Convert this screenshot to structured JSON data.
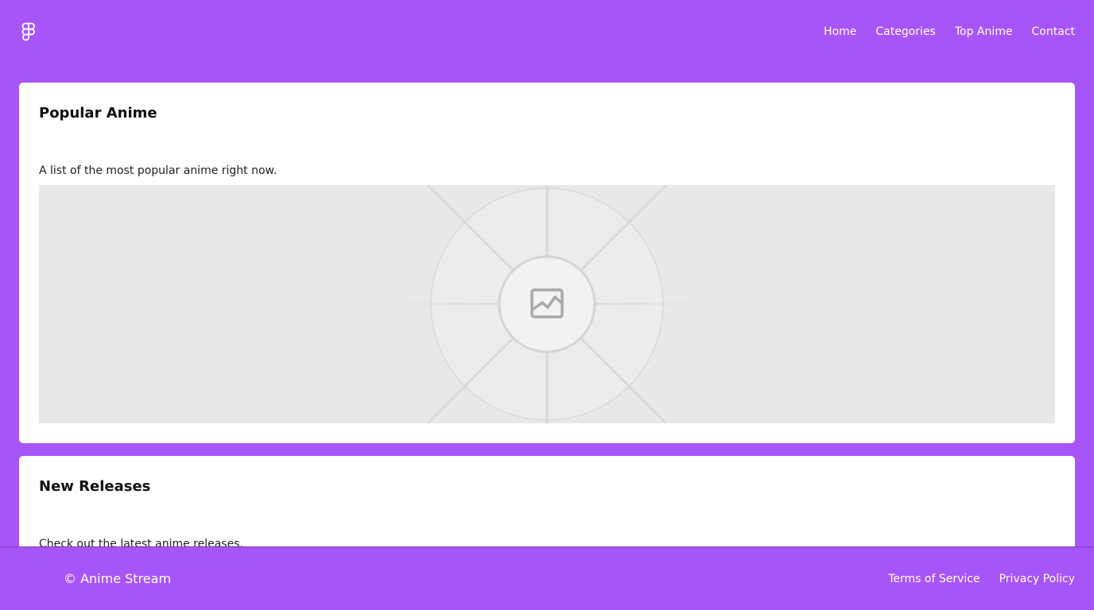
{
  "colors": {
    "brand_background": "#a855f7",
    "card_background": "#ffffff",
    "placeholder_background": "#e8e8e8"
  },
  "header": {
    "logo_icon": "figma-logo-icon",
    "nav": [
      {
        "label": "Home"
      },
      {
        "label": "Categories"
      },
      {
        "label": "Top Anime"
      },
      {
        "label": "Contact"
      }
    ]
  },
  "main": {
    "sections": [
      {
        "title": "Popular Anime",
        "description": "A list of the most popular anime right now.",
        "image_icon": "image-placeholder-icon"
      },
      {
        "title": "New Releases",
        "description": "Check out the latest anime releases."
      }
    ]
  },
  "footer": {
    "copyright": "© Anime Stream",
    "links": [
      {
        "label": "Terms of Service"
      },
      {
        "label": "Privacy Policy"
      }
    ]
  }
}
